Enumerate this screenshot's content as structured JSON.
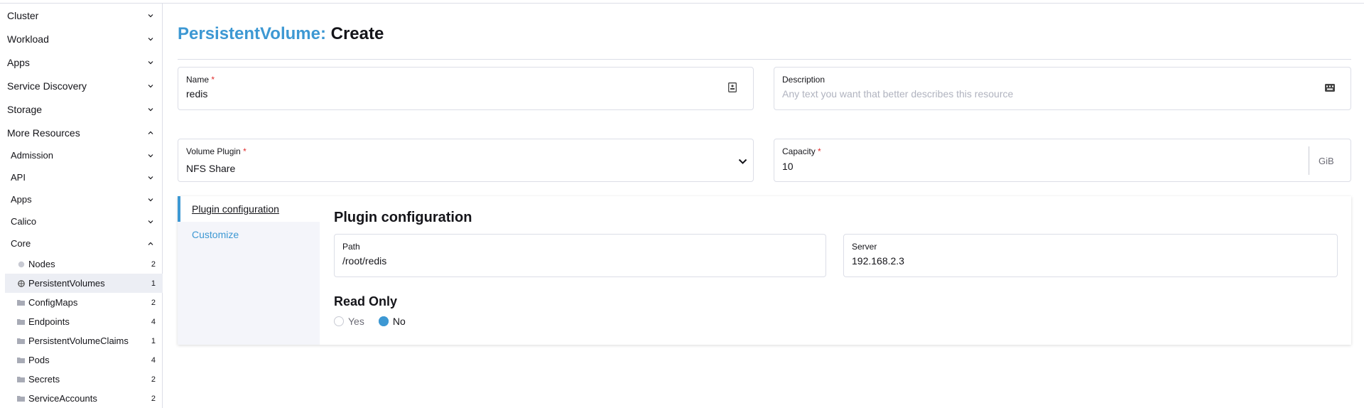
{
  "sidebar": {
    "groups": [
      {
        "label": "Cluster",
        "state": "collapsed"
      },
      {
        "label": "Workload",
        "state": "collapsed"
      },
      {
        "label": "Apps",
        "state": "collapsed"
      },
      {
        "label": "Service Discovery",
        "state": "collapsed"
      },
      {
        "label": "Storage",
        "state": "collapsed"
      },
      {
        "label": "More Resources",
        "state": "expanded"
      }
    ],
    "subgroups": [
      {
        "label": "Admission",
        "state": "collapsed"
      },
      {
        "label": "API",
        "state": "collapsed"
      },
      {
        "label": "Apps",
        "state": "collapsed"
      },
      {
        "label": "Calico",
        "state": "collapsed"
      },
      {
        "label": "Core",
        "state": "expanded"
      }
    ],
    "leaves": [
      {
        "label": "Nodes",
        "count": "2",
        "icon": "circle-icon"
      },
      {
        "label": "PersistentVolumes",
        "count": "1",
        "icon": "globe-icon",
        "active": true
      },
      {
        "label": "ConfigMaps",
        "count": "2",
        "icon": "folder-icon"
      },
      {
        "label": "Endpoints",
        "count": "4",
        "icon": "folder-icon"
      },
      {
        "label": "PersistentVolumeClaims",
        "count": "1",
        "icon": "folder-icon"
      },
      {
        "label": "Pods",
        "count": "4",
        "icon": "folder-icon"
      },
      {
        "label": "Secrets",
        "count": "2",
        "icon": "folder-icon"
      },
      {
        "label": "ServiceAccounts",
        "count": "2",
        "icon": "folder-icon"
      }
    ]
  },
  "header": {
    "resource": "PersistentVolume:",
    "action": "Create"
  },
  "form": {
    "name": {
      "label": "Name",
      "required": "*",
      "value": "redis"
    },
    "description": {
      "label": "Description",
      "placeholder": "Any text you want that better describes this resource"
    },
    "volume_plugin": {
      "label": "Volume Plugin",
      "required": "*",
      "value": "NFS Share"
    },
    "capacity": {
      "label": "Capacity",
      "required": "*",
      "value": "10",
      "unit": "GiB"
    }
  },
  "tabs": [
    {
      "label": "Plugin configuration",
      "active": true
    },
    {
      "label": "Customize",
      "active": false
    }
  ],
  "plugin_config": {
    "title": "Plugin configuration",
    "path": {
      "label": "Path",
      "value": "/root/redis"
    },
    "server": {
      "label": "Server",
      "value": "192.168.2.3"
    },
    "read_only": {
      "title": "Read Only",
      "options": [
        {
          "label": "Yes",
          "checked": false
        },
        {
          "label": "No",
          "checked": true
        }
      ]
    }
  },
  "colors": {
    "accent": "#3d98d3",
    "required": "#e02b2b",
    "border": "#dcdee7",
    "active_bg": "#eceef4"
  }
}
